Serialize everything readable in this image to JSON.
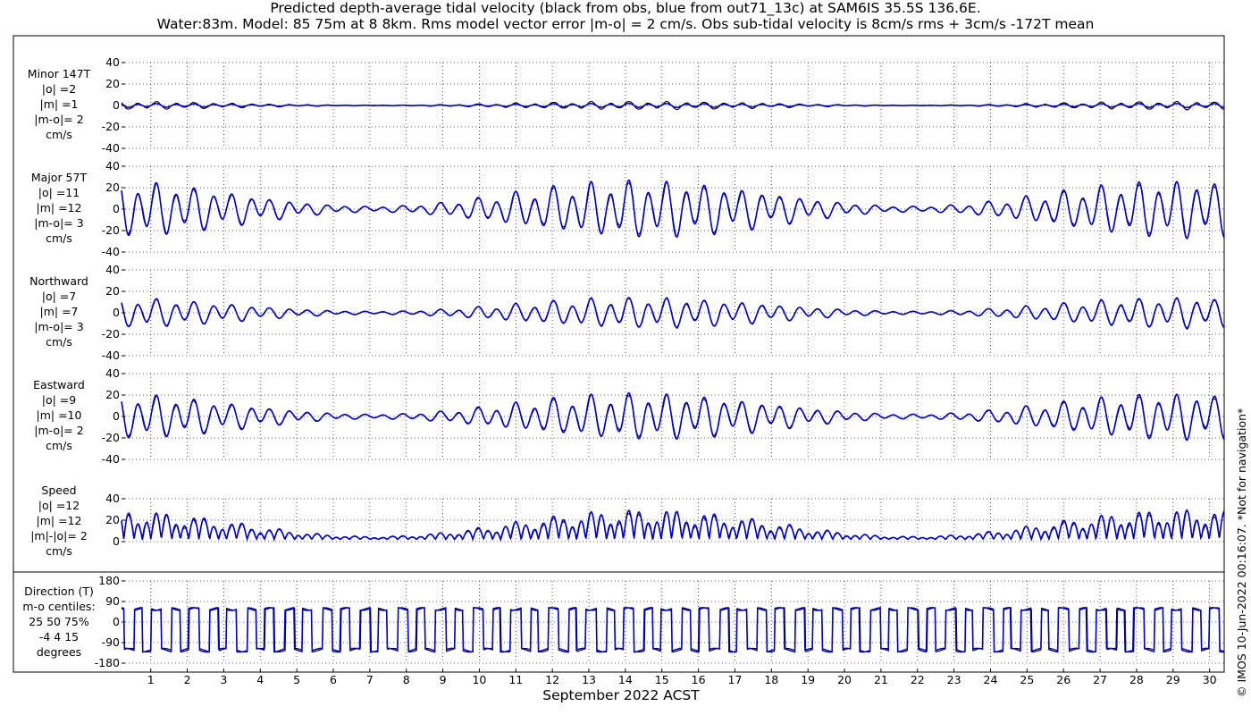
{
  "title": {
    "line1": "Predicted depth-average tidal velocity (black from obs, blue from out71_13c) at SAM6IS 35.5S 136.6E.",
    "line2": "Water:83m. Model: 85 75m at 8 8km. Rms model vector error |m-o| = 2 cm/s. Obs sub-tidal velocity is 8cm/s rms + 3cm/s -172T mean"
  },
  "credit": "© IMOS 10-Jun-2022 00:16:07. *Not for navigation*",
  "colors": {
    "obs": "#000000",
    "model": "#0000cc"
  },
  "chart_data": [
    {
      "type": "line",
      "panel": "minor",
      "labels": [
        "Minor 147T",
        "|o| =2",
        "|m| =1",
        "|m-o|= 2",
        "cm/s"
      ],
      "ylim": [
        -40,
        40
      ],
      "yticks": [
        -40,
        -20,
        0,
        20,
        40
      ],
      "xlabel": "September 2022 ACST",
      "xlim": [
        0.2,
        30.4
      ],
      "xticks": [
        1,
        2,
        3,
        4,
        5,
        6,
        7,
        8,
        9,
        10,
        11,
        12,
        13,
        14,
        15,
        16,
        17,
        18,
        19,
        20,
        21,
        22,
        23,
        24,
        25,
        26,
        27,
        28,
        29,
        30
      ],
      "grid": true,
      "series": [
        {
          "color": "#000000",
          "amplitude": 3,
          "mean": 0
        },
        {
          "color": "#0000cc",
          "amplitude": 1.5,
          "mean": 0
        }
      ]
    },
    {
      "type": "line",
      "panel": "major",
      "labels": [
        "Major 57T",
        "|o| =11",
        "|m| =12",
        "|m-o|= 3",
        "cm/s"
      ],
      "ylim": [
        -40,
        40
      ],
      "yticks": [
        -40,
        -20,
        0,
        20,
        40
      ],
      "grid": true,
      "series": [
        {
          "color": "#000000",
          "amplitude": 20,
          "mean": 0
        },
        {
          "color": "#0000cc",
          "amplitude": 21,
          "mean": 0
        }
      ]
    },
    {
      "type": "line",
      "panel": "northward",
      "labels": [
        "Northward",
        "|o| =7",
        "|m| =7",
        "|m-o|= 3",
        "cm/s"
      ],
      "ylim": [
        -40,
        40
      ],
      "yticks": [
        -40,
        -20,
        0,
        20,
        40
      ],
      "grid": true,
      "series": [
        {
          "color": "#000000",
          "amplitude": 11,
          "mean": 0
        },
        {
          "color": "#0000cc",
          "amplitude": 11,
          "mean": 0
        }
      ]
    },
    {
      "type": "line",
      "panel": "eastward",
      "labels": [
        "Eastward",
        "|o| =9",
        "|m| =10",
        "|m-o|= 2",
        "cm/s"
      ],
      "ylim": [
        -40,
        40
      ],
      "yticks": [
        -40,
        -20,
        0,
        20,
        40
      ],
      "grid": true,
      "series": [
        {
          "color": "#000000",
          "amplitude": 16,
          "mean": 0
        },
        {
          "color": "#0000cc",
          "amplitude": 17,
          "mean": 0
        }
      ]
    },
    {
      "type": "line",
      "panel": "speed",
      "labels": [
        "Speed",
        "|o| =12",
        "|m| =12",
        "|m|-|o|= 2",
        "cm/s"
      ],
      "ylim": [
        0,
        40
      ],
      "yticks": [
        0,
        20,
        40
      ],
      "grid": true,
      "series": [
        {
          "color": "#000000",
          "amplitude": 20,
          "mean": 10
        },
        {
          "color": "#0000cc",
          "amplitude": 21,
          "mean": 10
        }
      ]
    },
    {
      "type": "line",
      "panel": "direction",
      "labels": [
        "Direction (T)",
        "m-o centiles:",
        "25  50  75%",
        "-4   4  15",
        "degrees"
      ],
      "ylim": [
        -180,
        180
      ],
      "yticks": [
        -180,
        -90,
        0,
        90,
        180
      ],
      "grid": true,
      "series": [
        {
          "color": "#000000",
          "levels": [
            57,
            -123
          ]
        },
        {
          "color": "#0000cc",
          "levels": [
            57,
            -123
          ]
        }
      ]
    }
  ]
}
